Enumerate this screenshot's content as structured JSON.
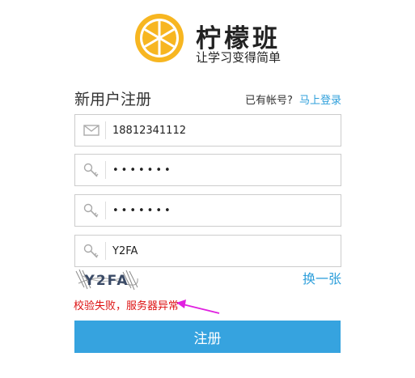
{
  "brand": {
    "name": "柠檬班",
    "slogan": "让学习变得简单",
    "logo_icon": "lemon-slice-icon",
    "logo_color": "#f7b621"
  },
  "form": {
    "title": "新用户注册",
    "login_prompt": "已有帐号?",
    "login_link": "马上登录",
    "phone_value": "18812341112",
    "password_value": "•••••••",
    "confirm_password_value": "•••••••",
    "captcha_value": "Y2FA",
    "captcha_image_text": "Y2FA",
    "refresh_label": "换一张",
    "error_message": "校验失败，服务器异常",
    "submit_label": "注册"
  },
  "icons": {
    "phone_field": "envelope-icon",
    "password_field": "key-icon",
    "confirm_field": "key-icon",
    "captcha_field": "key-icon"
  },
  "colors": {
    "accent": "#36a3df",
    "link": "#2e9fdb",
    "error": "#dd1111",
    "annotation_arrow": "#e020e0"
  }
}
